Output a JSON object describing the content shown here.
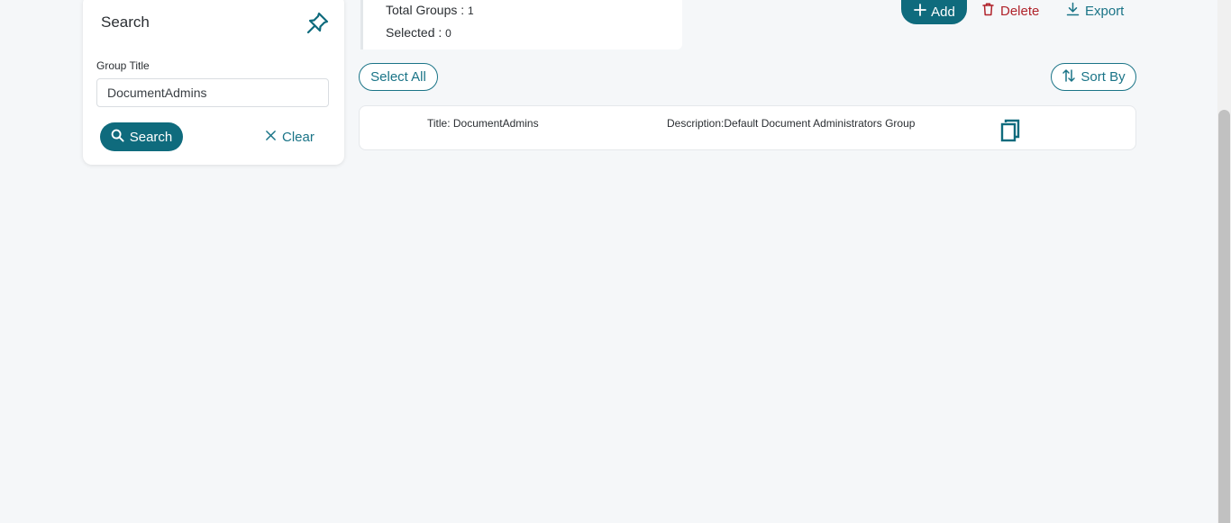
{
  "search_panel": {
    "title": "Search",
    "field_label": "Group Title",
    "field_value": "DocumentAdmins",
    "search_label": "Search",
    "clear_label": "Clear"
  },
  "summary": {
    "total_label": "Total Groups :",
    "total_value": "1",
    "selected_label": "Selected :",
    "selected_value": "0"
  },
  "actions": {
    "add_label": "Add",
    "delete_label": "Delete",
    "export_label": "Export"
  },
  "list_controls": {
    "select_all_label": "Select All",
    "sort_label": "Sort By"
  },
  "results": [
    {
      "title": "Title: DocumentAdmins",
      "description": "Description:Default Document Administrators Group"
    }
  ],
  "colors": {
    "primary": "#0f6b7d",
    "danger": "#b0232b",
    "background": "#f5f7f9"
  },
  "icons": {
    "pin": "pin-icon",
    "search": "search-icon",
    "clear": "close-icon",
    "add": "plus-icon",
    "delete": "trash-icon",
    "export": "download-icon",
    "sort": "sort-icon",
    "copy": "copy-icon"
  }
}
